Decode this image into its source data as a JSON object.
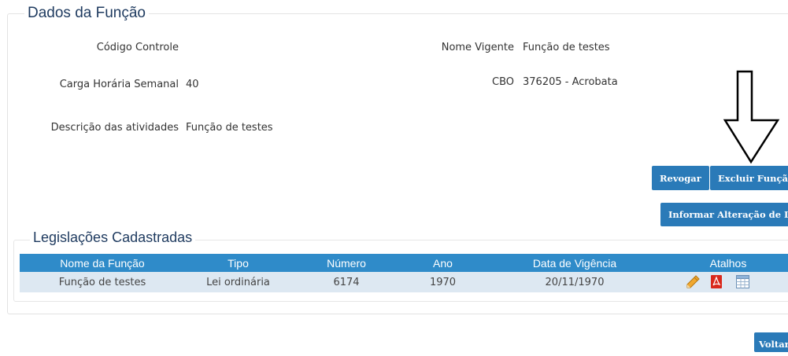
{
  "dados": {
    "legend": "Dados da Função",
    "codigo_label": "Código Controle",
    "codigo_value": "",
    "nome_label": "Nome Vigente",
    "nome_value": "Função de testes",
    "carga_label": "Carga Horária Semanal",
    "carga_value": "40",
    "cbo_label": "CBO",
    "cbo_value": "376205 - Acrobata",
    "descricao_label": "Descrição das atividades",
    "descricao_value": "Função de testes"
  },
  "actions": {
    "revogar": "Revogar",
    "excluir": "Excluir Função",
    "informar": "Informar Alteração de Lei",
    "voltar": "Voltar"
  },
  "legislacoes": {
    "legend": "Legislações Cadastradas",
    "columns": [
      "Nome da Função",
      "Tipo",
      "Número",
      "Ano",
      "Data de Vigência",
      "Atalhos"
    ],
    "rows": [
      {
        "nome": "Função de testes",
        "tipo": "Lei ordinária",
        "numero": "6174",
        "ano": "1970",
        "data": "20/11/1970",
        "icons": [
          "pencil-icon",
          "pdf-icon",
          "table-icon"
        ]
      }
    ]
  },
  "annotation": {
    "icon": "arrow-down-icon"
  },
  "colors": {
    "accent": "#2a7ab8",
    "table_header": "#2f8bc9",
    "row_bg": "#dde8f2",
    "legend": "#1e3a5f"
  }
}
